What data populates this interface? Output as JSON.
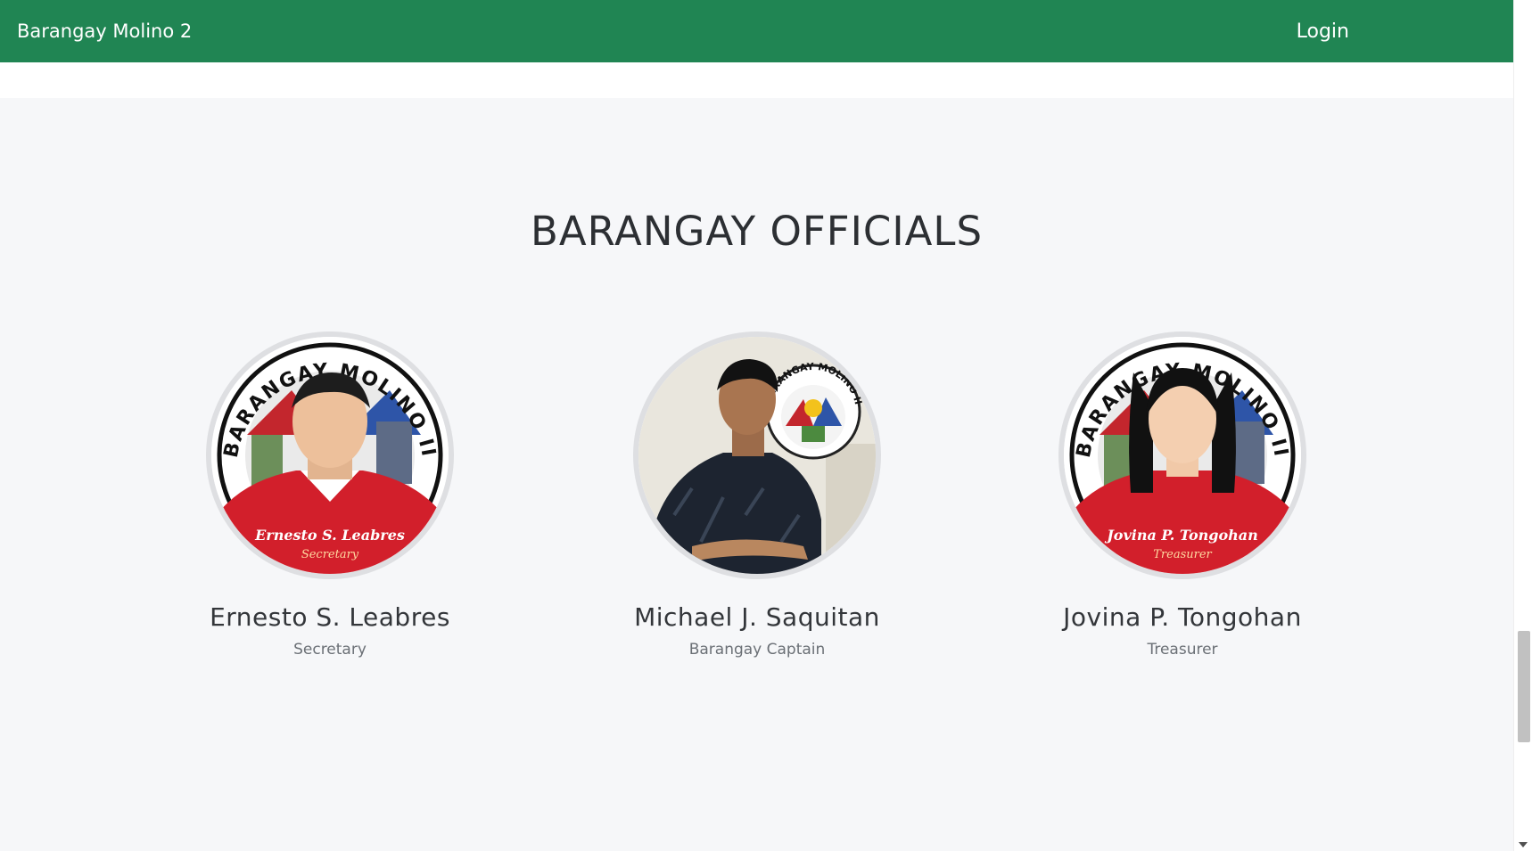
{
  "navbar": {
    "brand": "Barangay Molino 2",
    "login_label": "Login"
  },
  "section": {
    "title": "BARANGAY OFFICIALS"
  },
  "officials": [
    {
      "name": "Ernesto S. Leabres",
      "role": "Secretary",
      "badge_text": "BARANGAY MOLINO II",
      "shirt_caption": "Ernesto S. Leabres",
      "shirt_subcaption": "Secretary"
    },
    {
      "name": "Michael J. Saquitan",
      "role": "Barangay Captain",
      "badge_text": "BARANGAY MOLINO II"
    },
    {
      "name": "Jovina P. Tongohan",
      "role": "Treasurer",
      "badge_text": "BARANGAY MOLINO II",
      "shirt_caption": "Jovina P. Tongohan",
      "shirt_subcaption": "Treasurer"
    }
  ],
  "colors": {
    "navbar_bg": "#208553",
    "section_bg": "#f6f7f9",
    "shirt_red": "#d21f2b"
  },
  "scrollbar": {
    "position_fraction": 0.8
  }
}
